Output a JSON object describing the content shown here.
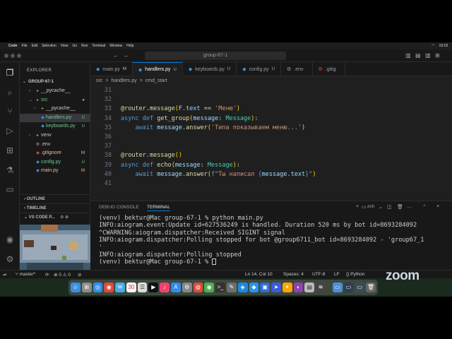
{
  "menubar": {
    "items": [
      "Code",
      "File",
      "Edit",
      "Selection",
      "View",
      "Go",
      "Run",
      "Terminal",
      "Window",
      "Help"
    ],
    "clock": "19:18"
  },
  "window": {
    "title_search": "group-67-1"
  },
  "sidebar": {
    "title": "EXPLORER",
    "root": "GROUP-67-1",
    "tree": [
      {
        "label": "__pycache__",
        "depth": 1,
        "arrow": "›",
        "icon": "folder-icon",
        "badge": "",
        "badge_type": ""
      },
      {
        "label": "src",
        "depth": 1,
        "arrow": "⌄",
        "icon": "folder-icon",
        "badge": "●",
        "badge_type": "green"
      },
      {
        "label": "__pycache__",
        "depth": 2,
        "arrow": "›",
        "icon": "folder-icon",
        "badge": "",
        "badge_type": ""
      },
      {
        "label": "handlers.py",
        "depth": 2,
        "arrow": "",
        "icon": "python-icon",
        "badge": "U",
        "badge_type": "green",
        "selected": true
      },
      {
        "label": "keyboards.py",
        "depth": 2,
        "arrow": "",
        "icon": "python-icon",
        "badge": "U",
        "badge_type": "green"
      },
      {
        "label": "venv",
        "depth": 1,
        "arrow": "›",
        "icon": "folder-icon",
        "badge": "",
        "badge_type": ""
      },
      {
        "label": ".env",
        "depth": 1,
        "arrow": "",
        "icon": "settings-file-icon",
        "badge": "",
        "badge_type": ""
      },
      {
        "label": ".gitignore",
        "depth": 1,
        "arrow": "",
        "icon": "git-icon",
        "badge": "M",
        "badge_type": "yellow"
      },
      {
        "label": "config.py",
        "depth": 1,
        "arrow": "",
        "icon": "python-icon",
        "badge": "U",
        "badge_type": "green"
      },
      {
        "label": "main.py",
        "depth": 1,
        "arrow": "",
        "icon": "python-icon",
        "badge": "M",
        "badge_type": "yellow"
      }
    ],
    "outline": "OUTLINE",
    "timeline": "TIMELINE",
    "vscode_pets": "VS CODE P..."
  },
  "tabs": [
    {
      "label": "main.py",
      "mod": "M",
      "mod_type": "m",
      "active": false
    },
    {
      "label": "handlers.py",
      "mod": "U",
      "mod_type": "u",
      "active": true
    },
    {
      "label": "keyboards.py",
      "mod": "U",
      "mod_type": "u",
      "active": false
    },
    {
      "label": "config.py",
      "mod": "U",
      "mod_type": "u",
      "active": false
    },
    {
      "label": ".env",
      "mod": "",
      "mod_type": "",
      "active": false
    },
    {
      "label": ".gitig",
      "mod": "",
      "mod_type": "",
      "active": false
    }
  ],
  "breadcrumb": {
    "parts": [
      "src",
      ">",
      "handlers.py",
      ">",
      "cmd_start"
    ]
  },
  "code": [
    {
      "n": "31",
      "tokens": []
    },
    {
      "n": "32",
      "tokens": []
    },
    {
      "n": "33",
      "tokens": [
        [
          "dec",
          "@router"
        ],
        [
          "",
          "."
        ],
        [
          "fn",
          "message"
        ],
        [
          "brk",
          "("
        ],
        [
          "var",
          "F"
        ],
        [
          "",
          "."
        ],
        [
          "var",
          "text"
        ],
        [
          "",
          " == "
        ],
        [
          "str",
          "'Меню'"
        ],
        [
          "brk",
          ")"
        ]
      ]
    },
    {
      "n": "34",
      "tokens": [
        [
          "kw",
          "async"
        ],
        [
          "",
          " "
        ],
        [
          "kw",
          "def"
        ],
        [
          "",
          " "
        ],
        [
          "fn",
          "get_group"
        ],
        [
          "brk",
          "("
        ],
        [
          "var",
          "message"
        ],
        [
          "",
          ": "
        ],
        [
          "ty",
          "Message"
        ],
        [
          "brk",
          ")"
        ],
        [
          "",
          ":"
        ]
      ]
    },
    {
      "n": "35",
      "tokens": [
        [
          "",
          "    "
        ],
        [
          "kw",
          "await"
        ],
        [
          "",
          " "
        ],
        [
          "var",
          "message"
        ],
        [
          "",
          "."
        ],
        [
          "fn",
          "answer"
        ],
        [
          "brk",
          "("
        ],
        [
          "str",
          "'Типа показываем меню...'"
        ],
        [
          "brk",
          ")"
        ]
      ]
    },
    {
      "n": "36",
      "tokens": []
    },
    {
      "n": "37",
      "tokens": []
    },
    {
      "n": "38",
      "tokens": [
        [
          "dec",
          "@router"
        ],
        [
          "",
          "."
        ],
        [
          "fn",
          "message"
        ],
        [
          "brk",
          "()"
        ]
      ]
    },
    {
      "n": "39",
      "tokens": [
        [
          "kw",
          "async"
        ],
        [
          "",
          " "
        ],
        [
          "kw",
          "def"
        ],
        [
          "",
          " "
        ],
        [
          "fn",
          "echo"
        ],
        [
          "brk",
          "("
        ],
        [
          "var",
          "message"
        ],
        [
          "",
          ": "
        ],
        [
          "ty",
          "Message"
        ],
        [
          "brk",
          ")"
        ],
        [
          "",
          ":"
        ]
      ]
    },
    {
      "n": "40",
      "tokens": [
        [
          "",
          "    "
        ],
        [
          "kw",
          "await"
        ],
        [
          "",
          " "
        ],
        [
          "var",
          "message"
        ],
        [
          "",
          "."
        ],
        [
          "fn",
          "answer"
        ],
        [
          "brk",
          "("
        ],
        [
          "kw",
          "f"
        ],
        [
          "str",
          "\"Ты написал "
        ],
        [
          "kw",
          "{"
        ],
        [
          "var",
          "message.text"
        ],
        [
          "kw",
          "}"
        ],
        [
          "str",
          "\""
        ],
        [
          "brk",
          ")"
        ]
      ]
    },
    {
      "n": "41",
      "tokens": []
    }
  ],
  "panel": {
    "debug_console": "DEBUG CONSOLE",
    "terminal": "TERMINAL",
    "shell": "zsh"
  },
  "terminal": [
    "(venv) bektur@Mac group-67-1 % python main.py",
    "INFO:aiogram.event:Update id=627536249 is handled. Duration 520 ms by bot id=8693284092",
    "^CWARNING:aiogram.dispatcher:Received SIGINT signal",
    "INFO:aiogram.dispatcher:Polling stopped for bot @group6711_bot id=8693284092 - 'group67_1",
    "'",
    "INFO:aiogram.dispatcher:Polling stopped",
    "(venv) bektur@Mac group-67-1 % "
  ],
  "statusbar": {
    "branch": "master*",
    "errors": "0",
    "warnings": "0",
    "position": "Ln 14, Col 10",
    "spaces": "Spaces: 4",
    "encoding": "UTF-8",
    "eol": "LF",
    "language": "Python"
  },
  "zoom": "zoom",
  "colors": {
    "accent": "#0078d4",
    "untracked": "#73c991",
    "modified": "#e2c08d"
  }
}
